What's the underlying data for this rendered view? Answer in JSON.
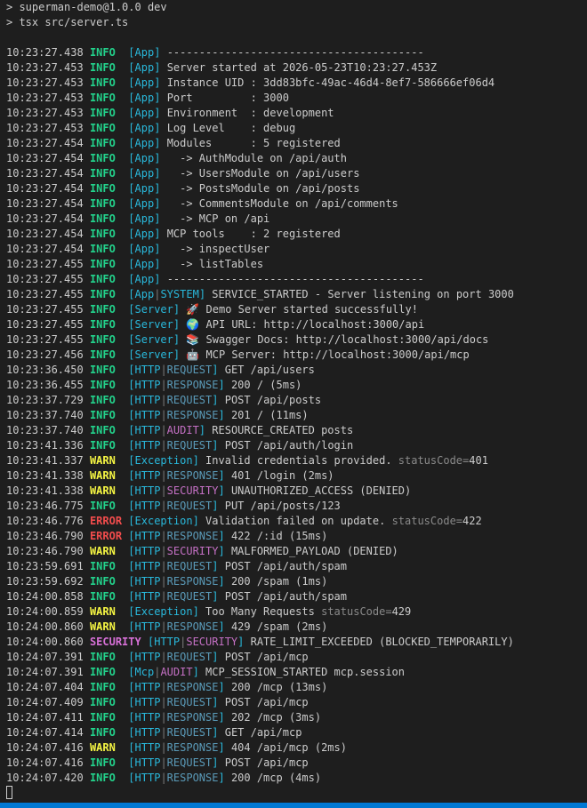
{
  "colors": {
    "background": "#1e1e1e",
    "text": "#cccccc",
    "info": "#23d18b",
    "warn": "#f5f543",
    "error": "#f14c4c",
    "security": "#d670d6",
    "context": "#29b8db",
    "status_bar": "#0078d4"
  },
  "commands": [
    "> superman-demo@1.0.0 dev",
    "> tsx src/server.ts"
  ],
  "logs": [
    {
      "ts": "10:23:27.438",
      "level": "INFO",
      "ctx": "App",
      "msg": "----------------------------------------"
    },
    {
      "ts": "10:23:27.453",
      "level": "INFO",
      "ctx": "App",
      "msg": "Server started at 2026-05-23T10:23:27.453Z"
    },
    {
      "ts": "10:23:27.453",
      "level": "INFO",
      "ctx": "App",
      "msg": "Instance UID : 3dd83bfc-49ac-46d4-8ef7-586666ef06d4"
    },
    {
      "ts": "10:23:27.453",
      "level": "INFO",
      "ctx": "App",
      "msg": "Port         : 3000"
    },
    {
      "ts": "10:23:27.453",
      "level": "INFO",
      "ctx": "App",
      "msg": "Environment  : development"
    },
    {
      "ts": "10:23:27.453",
      "level": "INFO",
      "ctx": "App",
      "msg": "Log Level    : debug"
    },
    {
      "ts": "10:23:27.454",
      "level": "INFO",
      "ctx": "App",
      "msg": "Modules      : 5 registered"
    },
    {
      "ts": "10:23:27.454",
      "level": "INFO",
      "ctx": "App",
      "msg": "  -> AuthModule on /api/auth"
    },
    {
      "ts": "10:23:27.454",
      "level": "INFO",
      "ctx": "App",
      "msg": "  -> UsersModule on /api/users"
    },
    {
      "ts": "10:23:27.454",
      "level": "INFO",
      "ctx": "App",
      "msg": "  -> PostsModule on /api/posts"
    },
    {
      "ts": "10:23:27.454",
      "level": "INFO",
      "ctx": "App",
      "msg": "  -> CommentsModule on /api/comments"
    },
    {
      "ts": "10:23:27.454",
      "level": "INFO",
      "ctx": "App",
      "msg": "  -> MCP on /api"
    },
    {
      "ts": "10:23:27.454",
      "level": "INFO",
      "ctx": "App",
      "msg": "MCP tools    : 2 registered"
    },
    {
      "ts": "10:23:27.454",
      "level": "INFO",
      "ctx": "App",
      "msg": "  -> inspectUser"
    },
    {
      "ts": "10:23:27.455",
      "level": "INFO",
      "ctx": "App",
      "msg": "  -> listTables"
    },
    {
      "ts": "10:23:27.455",
      "level": "INFO",
      "ctx": "App",
      "msg": "----------------------------------------"
    },
    {
      "ts": "10:23:27.455",
      "level": "INFO",
      "ctx": "App",
      "sub": "SYSTEM",
      "msg": "SERVICE_STARTED - Server listening on port 3000"
    },
    {
      "ts": "10:23:27.455",
      "level": "INFO",
      "ctx": "Server",
      "msg": "🚀 Demo Server started successfully!"
    },
    {
      "ts": "10:23:27.455",
      "level": "INFO",
      "ctx": "Server",
      "msg": "🌍 API URL: http://localhost:3000/api"
    },
    {
      "ts": "10:23:27.455",
      "level": "INFO",
      "ctx": "Server",
      "msg": "📚 Swagger Docs: http://localhost:3000/api/docs"
    },
    {
      "ts": "10:23:27.456",
      "level": "INFO",
      "ctx": "Server",
      "msg": "🤖 MCP Server: http://localhost:3000/api/mcp"
    },
    {
      "ts": "10:23:36.450",
      "level": "INFO",
      "ctx": "HTTP",
      "sub": "REQUEST",
      "msg": "GET /api/users"
    },
    {
      "ts": "10:23:36.455",
      "level": "INFO",
      "ctx": "HTTP",
      "sub": "RESPONSE",
      "msg": "200 / (5ms)"
    },
    {
      "ts": "10:23:37.729",
      "level": "INFO",
      "ctx": "HTTP",
      "sub": "REQUEST",
      "msg": "POST /api/posts"
    },
    {
      "ts": "10:23:37.740",
      "level": "INFO",
      "ctx": "HTTP",
      "sub": "RESPONSE",
      "msg": "201 / (11ms)"
    },
    {
      "ts": "10:23:37.740",
      "level": "INFO",
      "ctx": "HTTP",
      "sub": "AUDIT",
      "msg": "RESOURCE_CREATED posts"
    },
    {
      "ts": "10:23:41.336",
      "level": "INFO",
      "ctx": "HTTP",
      "sub": "REQUEST",
      "msg": "POST /api/auth/login"
    },
    {
      "ts": "10:23:41.337",
      "level": "WARN",
      "ctx": "Exception",
      "msg": "Invalid credentials provided.",
      "mkey": "statusCode=",
      "mval": "401"
    },
    {
      "ts": "10:23:41.338",
      "level": "WARN",
      "ctx": "HTTP",
      "sub": "RESPONSE",
      "msg": "401 /login (2ms)"
    },
    {
      "ts": "10:23:41.338",
      "level": "WARN",
      "ctx": "HTTP",
      "sub": "SECURITY",
      "msg": "UNAUTHORIZED_ACCESS (DENIED)"
    },
    {
      "ts": "10:23:46.775",
      "level": "INFO",
      "ctx": "HTTP",
      "sub": "REQUEST",
      "msg": "PUT /api/posts/123"
    },
    {
      "ts": "10:23:46.776",
      "level": "ERROR",
      "ctx": "Exception",
      "msg": "Validation failed on update.",
      "mkey": "statusCode=",
      "mval": "422"
    },
    {
      "ts": "10:23:46.790",
      "level": "ERROR",
      "ctx": "HTTP",
      "sub": "RESPONSE",
      "msg": "422 /:id (15ms)"
    },
    {
      "ts": "10:23:46.790",
      "level": "WARN",
      "ctx": "HTTP",
      "sub": "SECURITY",
      "msg": "MALFORMED_PAYLOAD (DENIED)"
    },
    {
      "ts": "10:23:59.691",
      "level": "INFO",
      "ctx": "HTTP",
      "sub": "REQUEST",
      "msg": "POST /api/auth/spam"
    },
    {
      "ts": "10:23:59.692",
      "level": "INFO",
      "ctx": "HTTP",
      "sub": "RESPONSE",
      "msg": "200 /spam (1ms)"
    },
    {
      "ts": "10:24:00.858",
      "level": "INFO",
      "ctx": "HTTP",
      "sub": "REQUEST",
      "msg": "POST /api/auth/spam"
    },
    {
      "ts": "10:24:00.859",
      "level": "WARN",
      "ctx": "Exception",
      "msg": "Too Many Requests",
      "mkey": "statusCode=",
      "mval": "429"
    },
    {
      "ts": "10:24:00.860",
      "level": "WARN",
      "ctx": "HTTP",
      "sub": "RESPONSE",
      "msg": "429 /spam (2ms)"
    },
    {
      "ts": "10:24:00.860",
      "level": "SECURITY",
      "ctx": "HTTP",
      "sub": "SECURITY",
      "msg": "RATE_LIMIT_EXCEEDED (BLOCKED_TEMPORARILY)"
    },
    {
      "ts": "10:24:07.391",
      "level": "INFO",
      "ctx": "HTTP",
      "sub": "REQUEST",
      "msg": "POST /api/mcp"
    },
    {
      "ts": "10:24:07.391",
      "level": "INFO",
      "ctx": "Mcp",
      "sub": "AUDIT",
      "msg": "MCP_SESSION_STARTED mcp.session"
    },
    {
      "ts": "10:24:07.404",
      "level": "INFO",
      "ctx": "HTTP",
      "sub": "RESPONSE",
      "msg": "200 /mcp (13ms)"
    },
    {
      "ts": "10:24:07.409",
      "level": "INFO",
      "ctx": "HTTP",
      "sub": "REQUEST",
      "msg": "POST /api/mcp"
    },
    {
      "ts": "10:24:07.411",
      "level": "INFO",
      "ctx": "HTTP",
      "sub": "RESPONSE",
      "msg": "202 /mcp (3ms)"
    },
    {
      "ts": "10:24:07.414",
      "level": "INFO",
      "ctx": "HTTP",
      "sub": "REQUEST",
      "msg": "GET /api/mcp"
    },
    {
      "ts": "10:24:07.416",
      "level": "WARN",
      "ctx": "HTTP",
      "sub": "RESPONSE",
      "msg": "404 /api/mcp (2ms)"
    },
    {
      "ts": "10:24:07.416",
      "level": "INFO",
      "ctx": "HTTP",
      "sub": "REQUEST",
      "msg": "POST /api/mcp"
    },
    {
      "ts": "10:24:07.420",
      "level": "INFO",
      "ctx": "HTTP",
      "sub": "RESPONSE",
      "msg": "200 /mcp (4ms)"
    }
  ]
}
